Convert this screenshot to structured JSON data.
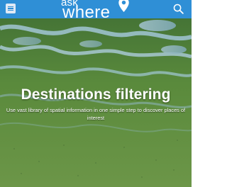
{
  "header": {
    "brand_ask": "ask",
    "brand_where": "where",
    "bar_color": "#2f8fd6",
    "menu_icon": "hamburger-menu-icon",
    "search_icon": "search-icon",
    "logo_icon": "map-pin-icon"
  },
  "hero": {
    "title": "Destinations filtering",
    "subtitle": "Use vast library of spatial information in one simple step to discover places of interest"
  }
}
